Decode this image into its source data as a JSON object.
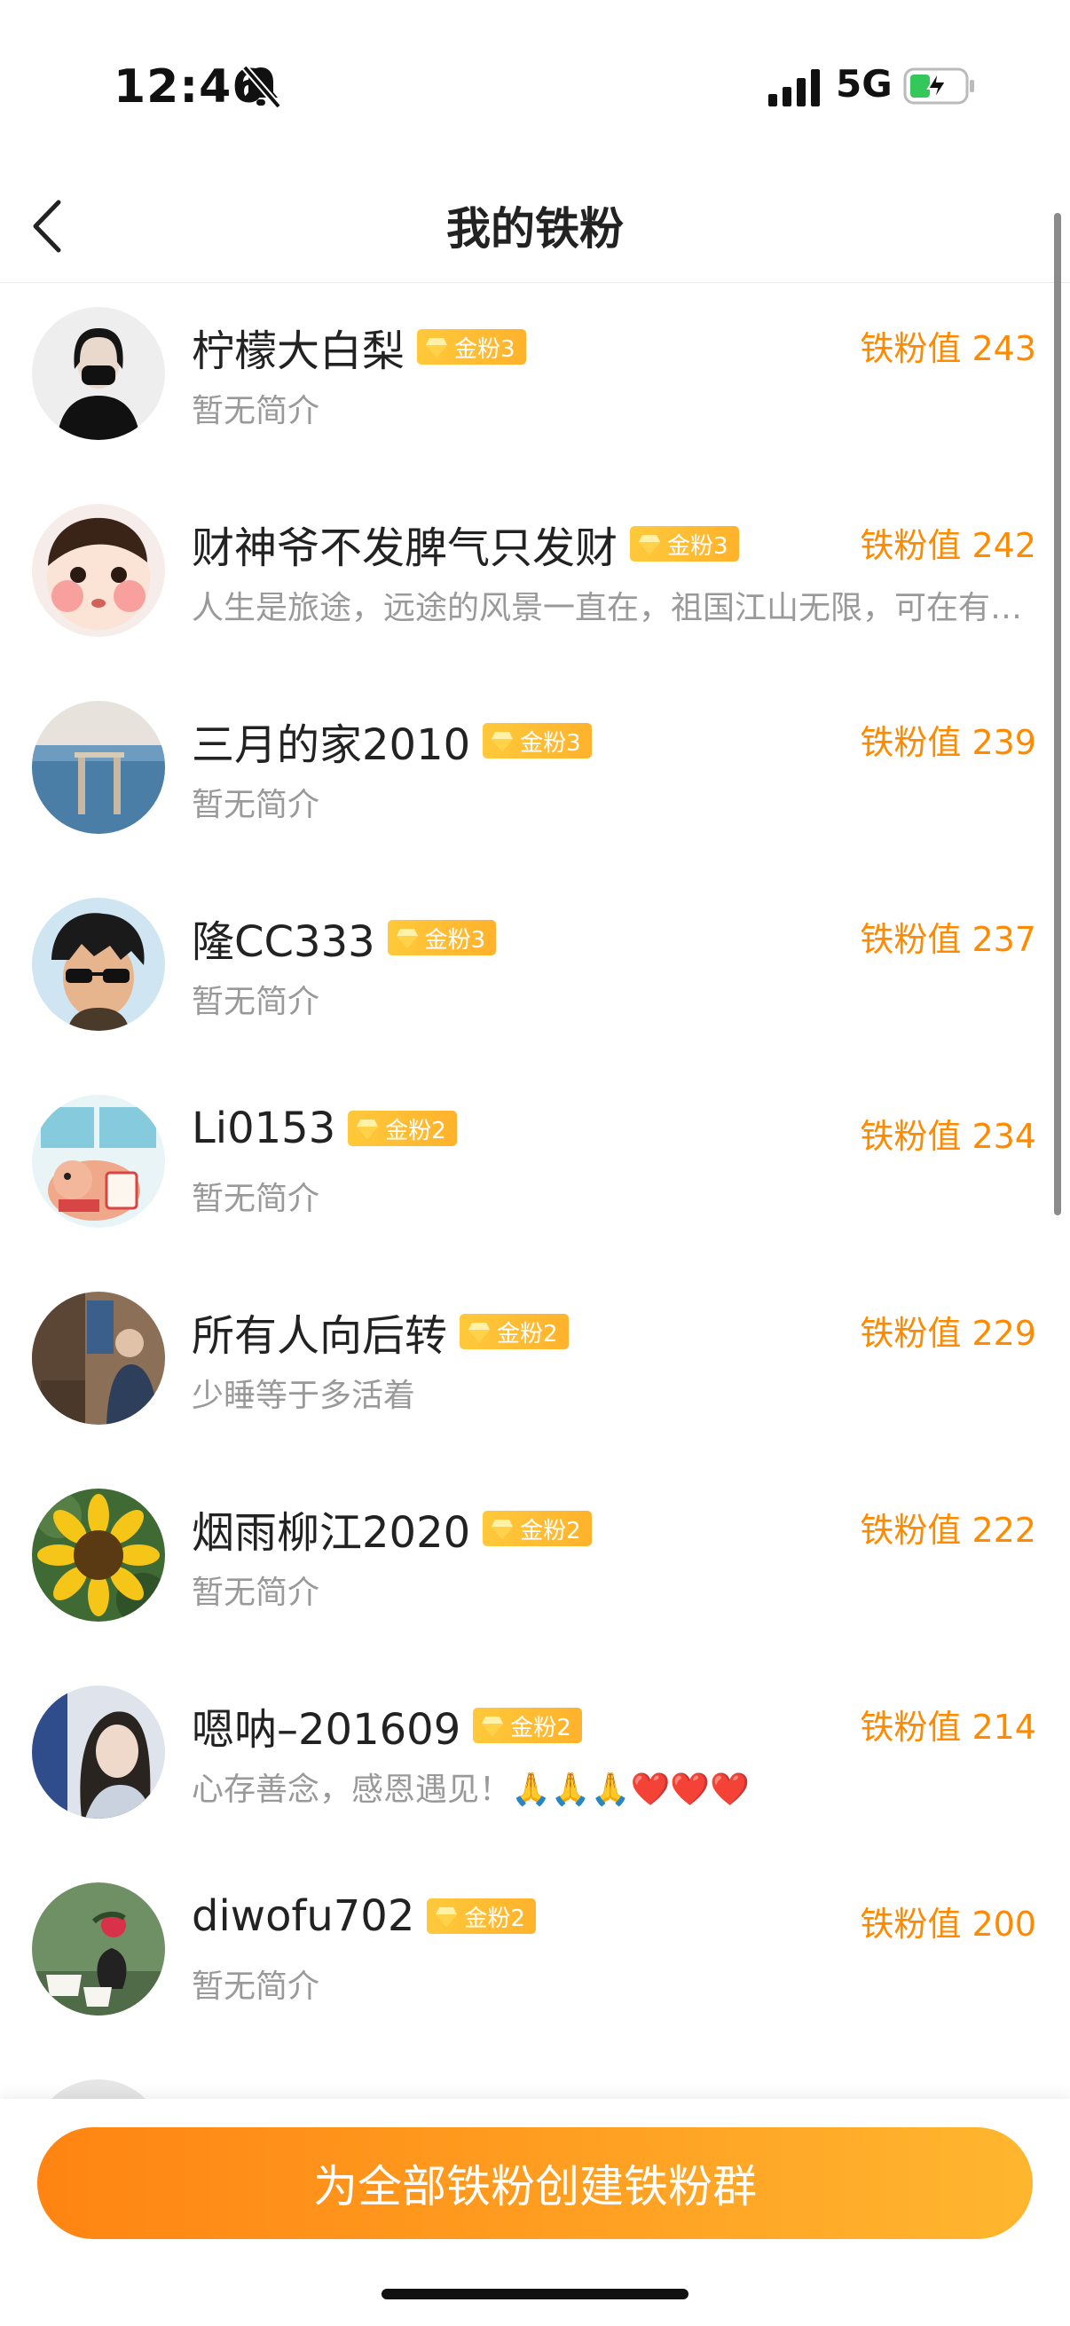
{
  "status": {
    "time": "12:46",
    "network": "5G"
  },
  "nav": {
    "title": "我的铁粉"
  },
  "fans": [
    {
      "name": "柠檬大白梨",
      "badge": "金粉3",
      "bio": "暂无简介",
      "score": "铁粉值 243",
      "avatar": "avatar-portrait-mask"
    },
    {
      "name": "财神爷不发脾气只发财",
      "badge": "金粉3",
      "bio": "人生是旅途，远途的风景一直在，祖国江山无限，可在有…",
      "score": "铁粉值 242",
      "avatar": "avatar-cartoon-baby"
    },
    {
      "name": "三月的家2010",
      "badge": "金粉3",
      "bio": "暂无简介",
      "score": "铁粉值 239",
      "avatar": "avatar-sea-love"
    },
    {
      "name": "隆CC333",
      "badge": "金粉3",
      "bio": "暂无简介",
      "score": "铁粉值 237",
      "avatar": "avatar-anime-sunglasses"
    },
    {
      "name": "Li0153",
      "badge": "金粉2",
      "bio": "暂无简介",
      "score": "铁粉值 234",
      "avatar": "avatar-facai"
    },
    {
      "name": "所有人向后转",
      "badge": "金粉2",
      "bio": "少睡等于多活着",
      "score": "铁粉值 229",
      "avatar": "avatar-photo-room"
    },
    {
      "name": "烟雨柳江2020",
      "badge": "金粉2",
      "bio": "暂无简介",
      "score": "铁粉值 222",
      "avatar": "avatar-sunflower"
    },
    {
      "name": "嗯呐–201609",
      "badge": "金粉2",
      "bio": "心存善念，感恩遇见！🙏🙏🙏❤️❤️❤️",
      "score": "铁粉值 214",
      "avatar": "avatar-woman-portrait"
    },
    {
      "name": "diwofu702",
      "badge": "金粉2",
      "bio": "暂无简介",
      "score": "铁粉值 200",
      "avatar": "avatar-tea-flower"
    }
  ],
  "cta": {
    "label": "为全部铁粉创建铁粉群"
  },
  "colors": {
    "accent": "#ff8a00",
    "badge": "#ffbe33",
    "cta_start": "#ff8412",
    "cta_end": "#ffb62f"
  }
}
